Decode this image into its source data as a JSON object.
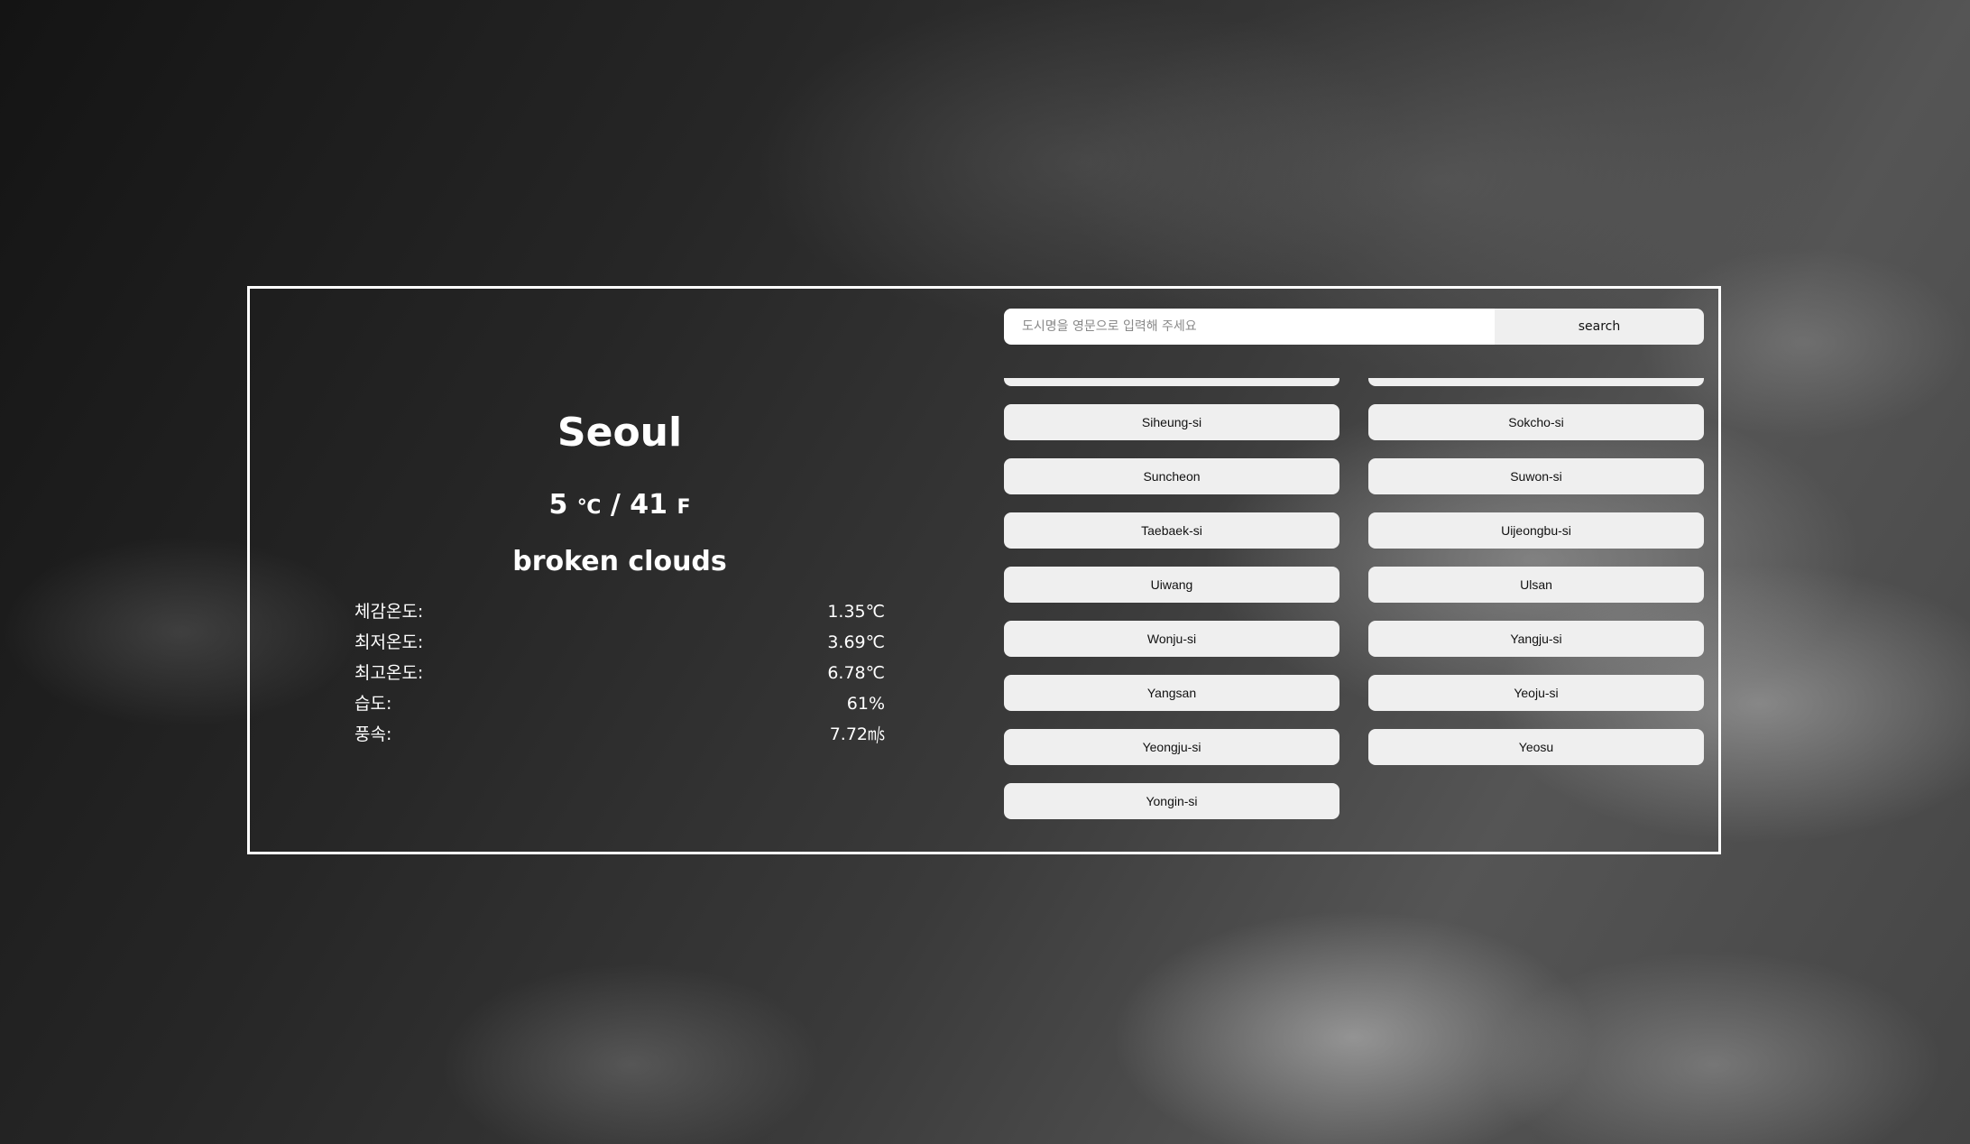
{
  "weather": {
    "city": "Seoul",
    "temp_c": "5",
    "unit_c": "℃",
    "temp_sep": " / ",
    "temp_f": "41",
    "unit_f": "F",
    "description": "broken clouds",
    "stats": [
      {
        "label": "체감온도:",
        "value": "1.35℃"
      },
      {
        "label": "최저온도:",
        "value": "3.69℃"
      },
      {
        "label": "최고온도:",
        "value": "6.78℃"
      },
      {
        "label": "습도:",
        "value": "61%"
      },
      {
        "label": "풍속:",
        "value": "7.72㎧"
      }
    ]
  },
  "search": {
    "placeholder": "도시명을 영문으로 입력해 주세요",
    "button_label": "search"
  },
  "cities": {
    "left": [
      "Siheung-si",
      "Suncheon",
      "Taebaek-si",
      "Uiwang",
      "Wonju-si",
      "Yangsan",
      "Yeongju-si",
      "Yongin-si"
    ],
    "right": [
      "Sokcho-si",
      "Suwon-si",
      "Uijeongbu-si",
      "Ulsan",
      "Yangju-si",
      "Yeoju-si",
      "Yeosu"
    ]
  }
}
